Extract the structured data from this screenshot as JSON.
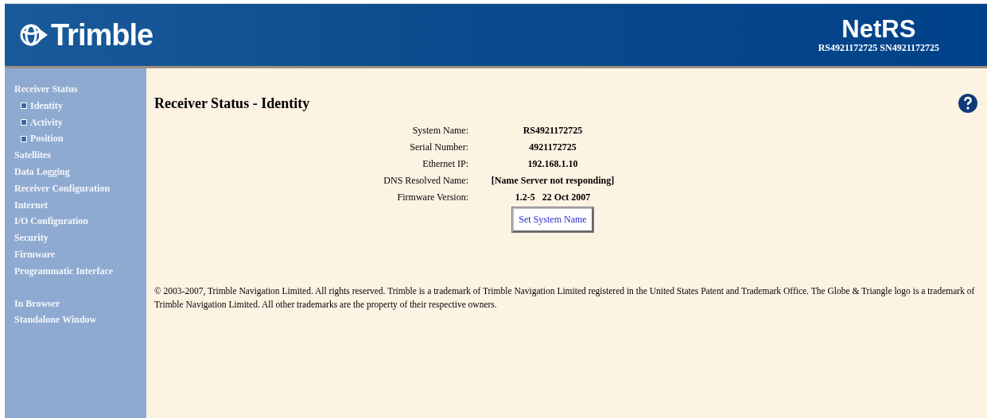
{
  "header": {
    "logo": "Trimble",
    "product": "NetRS",
    "device_ids": "RS4921172725 SN4921172725"
  },
  "sidebar": {
    "items": [
      {
        "label": "Receiver Status",
        "children": [
          {
            "label": "Identity"
          },
          {
            "label": "Activity"
          },
          {
            "label": "Position"
          }
        ]
      },
      {
        "label": "Satellites"
      },
      {
        "label": "Data Logging"
      },
      {
        "label": "Receiver Configuration"
      },
      {
        "label": "Internet"
      },
      {
        "label": "I/O Configuration"
      },
      {
        "label": "Security"
      },
      {
        "label": "Firmware"
      },
      {
        "label": "Programmatic Interface"
      }
    ],
    "view_items": [
      {
        "label": "In Browser"
      },
      {
        "label": "Standalone Window"
      }
    ]
  },
  "page": {
    "title": "Receiver Status - Identity",
    "fields": [
      {
        "label": "System Name:",
        "value": "RS4921172725"
      },
      {
        "label": "Serial Number:",
        "value": "4921172725"
      },
      {
        "label": "Ethernet IP:",
        "value": "192.168.1.10"
      },
      {
        "label": "DNS Resolved Name:",
        "value": "[Name Server not responding]"
      },
      {
        "label": "Firmware Version:",
        "value": "1.2-5   22 Oct 2007"
      }
    ],
    "button": "Set System Name",
    "copyright": "© 2003-2007, Trimble Navigation Limited. All rights reserved. Trimble is a trademark of Trimble Navigation Limited registered in the United States Patent and Trademark Office. The Globe & Triangle logo is a trademark of Trimble Navigation Limited. All other trademarks are the property of their respective owners."
  }
}
